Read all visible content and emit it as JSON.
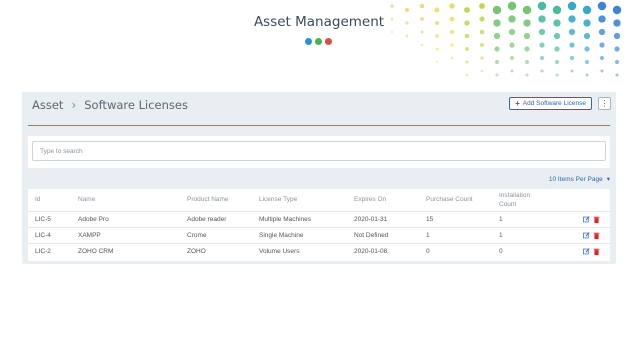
{
  "header": {
    "title": "Asset Management",
    "brand_dot_colors": [
      "#2d8fd6",
      "#49b649",
      "#e04a3f"
    ]
  },
  "breadcrumb": {
    "root": "Asset",
    "current": "Software Licenses"
  },
  "toolbar": {
    "add_label": "Add Software License",
    "more_icon": "vertical-ellipsis-icon"
  },
  "search": {
    "placeholder": "Type to search",
    "value": ""
  },
  "pagination": {
    "per_page_label": "10 Items Per Page"
  },
  "table": {
    "columns": [
      "Id",
      "Name",
      "Product Name",
      "License Type",
      "Expires On",
      "Purchase Count",
      "Installation Count"
    ],
    "rows": [
      [
        "LIC-5",
        "Adobe Pro",
        "Adobe reader",
        "Multiple Machines",
        "2020-01-31",
        "15",
        "1"
      ],
      [
        "LIC-4",
        "XAMPP",
        "Crome",
        "Single Machine",
        "Not Defined",
        "1",
        "1"
      ],
      [
        "LIC-2",
        "ZOHO CRM",
        "ZOHO",
        "Volume Users",
        "2020-01-08",
        "0",
        "0"
      ]
    ]
  },
  "colors": {
    "accent": "#2d67b8",
    "delete": "#d9262a",
    "panel": "#e9eef2"
  }
}
